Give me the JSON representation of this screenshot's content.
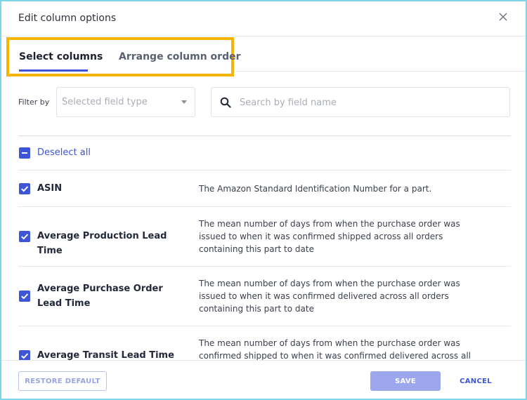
{
  "dialog": {
    "title": "Edit column options",
    "close_icon": "close-icon"
  },
  "tabs": [
    {
      "label": "Select columns",
      "active": true
    },
    {
      "label": "Arrange column order",
      "active": false
    }
  ],
  "filter": {
    "label": "Filter by",
    "field_type_placeholder": "Selected field type",
    "search_placeholder": "Search by field name",
    "search_value": ""
  },
  "deselect_all": {
    "label": "Deselect all",
    "state": "indeterminate"
  },
  "columns": [
    {
      "name": "ASIN",
      "checked": true,
      "description": "The Amazon Standard Identification Number for a part."
    },
    {
      "name": "Average Production Lead Time",
      "checked": true,
      "description": "The mean number of days from when the purchase order was issued to when it was confirmed shipped across all orders containing this part to date"
    },
    {
      "name": "Average Purchase Order Lead Time",
      "checked": true,
      "description": "The mean number of days from when the purchase order was issued to when it was confirmed delivered across all orders containing this part to date"
    },
    {
      "name": "Average Transit Lead Time",
      "checked": true,
      "description": "The mean number of days from when the purchase order was confirmed shipped to when it was confirmed delivered across all"
    }
  ],
  "footer": {
    "restore_label": "RESTORE DEFAULT",
    "save_label": "SAVE",
    "cancel_label": "CANCEL"
  },
  "colors": {
    "accent": "#3d55d6",
    "highlight_border": "#f5b400",
    "save_disabled": "#9ca7ee"
  }
}
